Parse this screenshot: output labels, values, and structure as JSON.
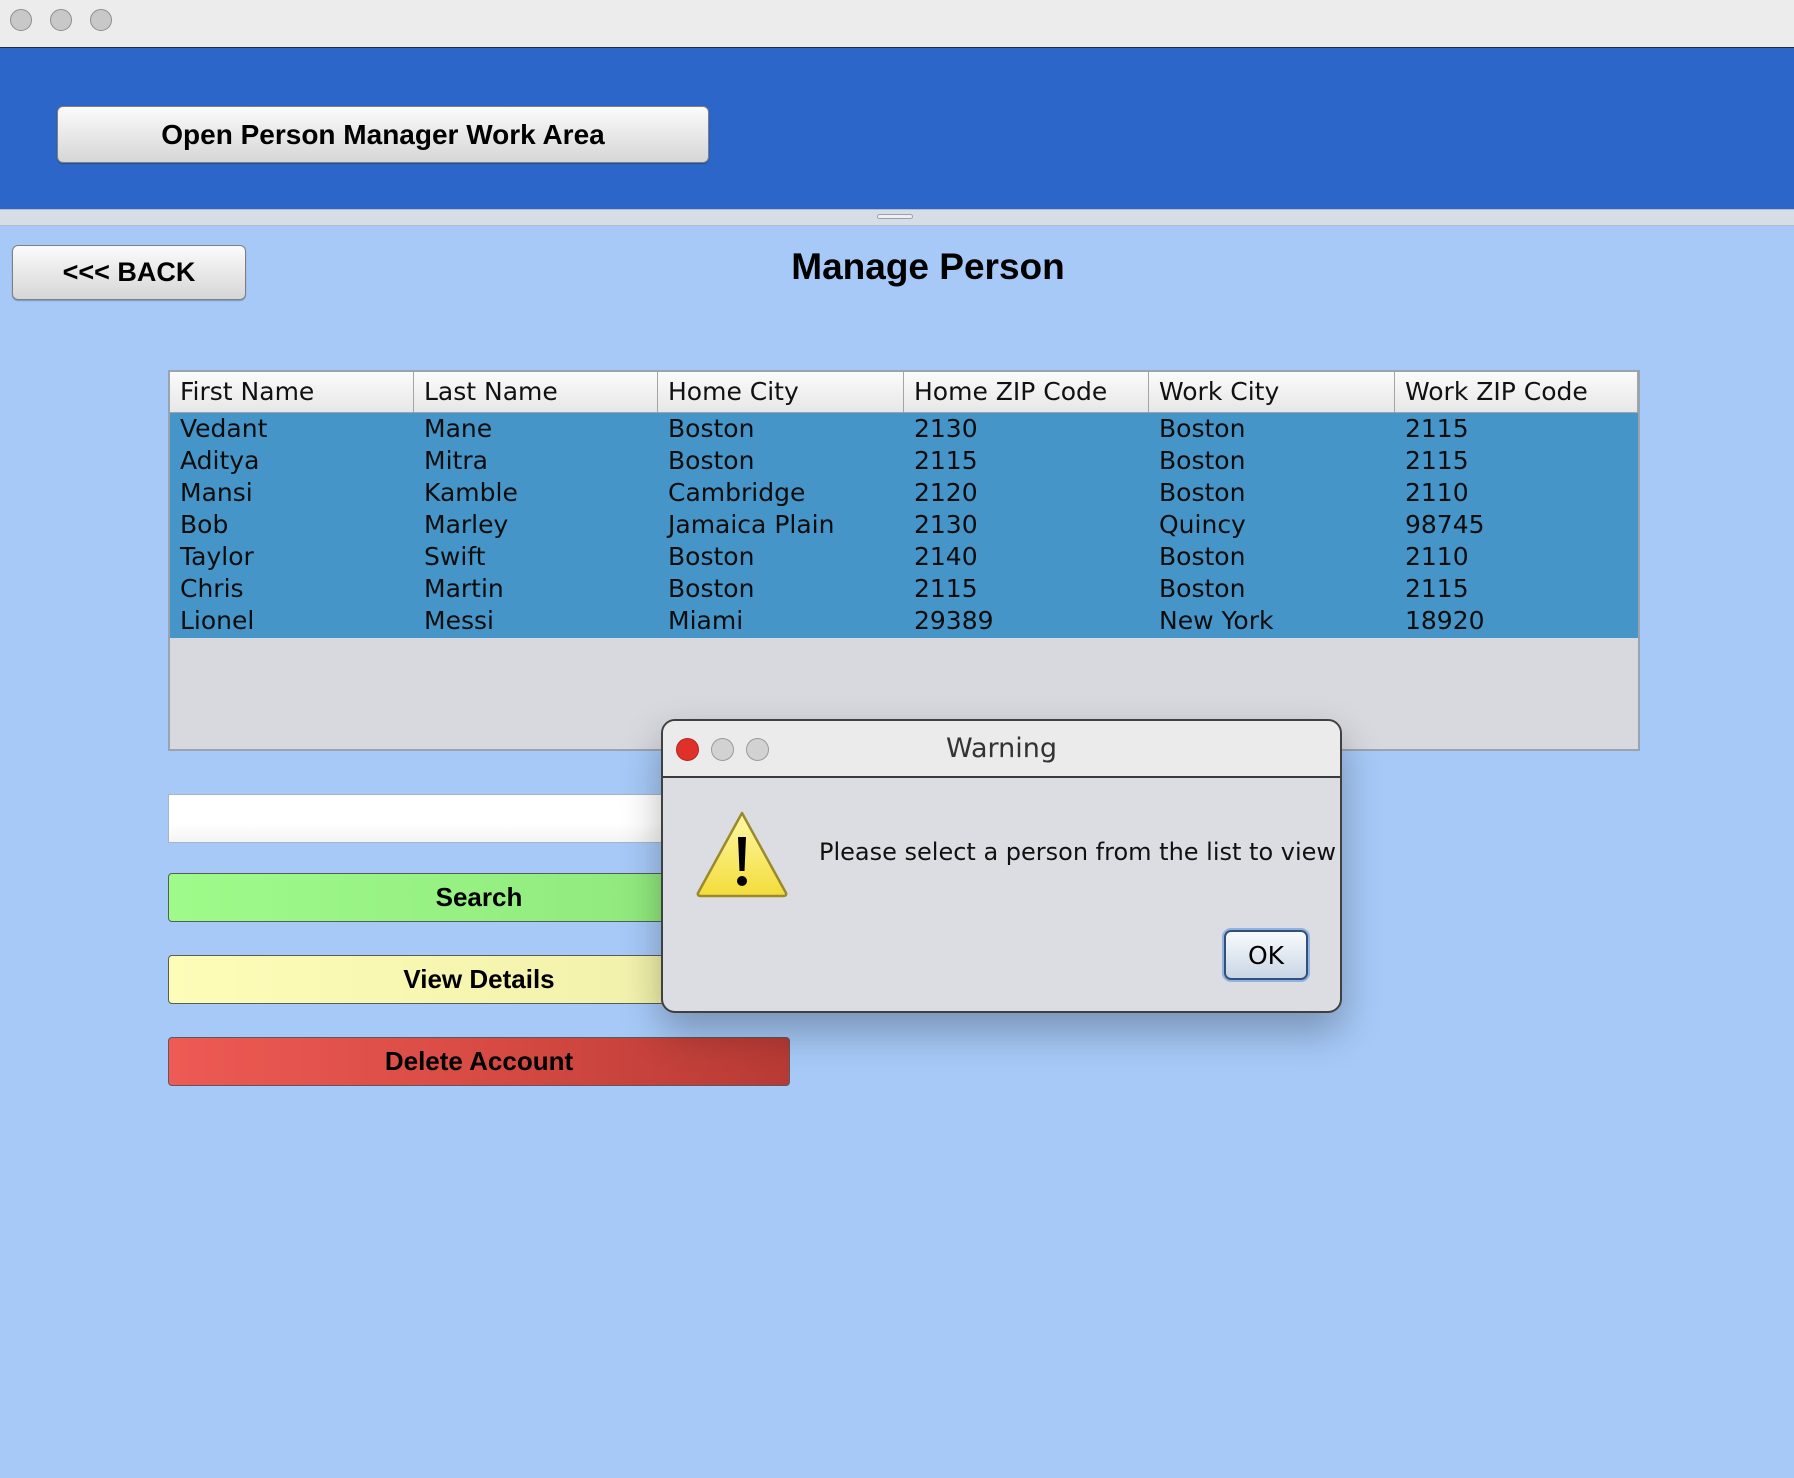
{
  "window": {
    "traffic_lights": [
      "close-button",
      "minimize-button",
      "zoom-button"
    ]
  },
  "top_bar": {
    "open_button_label": "Open Person Manager Work Area"
  },
  "main": {
    "back_label": "<<< BACK",
    "title": "Manage Person",
    "table": {
      "columns": [
        "First Name",
        "Last Name",
        "Home City",
        "Home ZIP Code",
        "Work City",
        "Work ZIP Code"
      ],
      "rows": [
        [
          "Vedant",
          "Mane",
          "Boston",
          "2130",
          "Boston",
          "2115"
        ],
        [
          "Aditya",
          "Mitra",
          "Boston",
          "2115",
          "Boston",
          "2115"
        ],
        [
          "Mansi",
          "Kamble",
          "Cambridge",
          "2120",
          "Boston",
          "2110"
        ],
        [
          "Bob",
          "Marley",
          "Jamaica Plain",
          "2130",
          "Quincy",
          "98745"
        ],
        [
          "Taylor",
          "Swift",
          "Boston",
          "2140",
          "Boston",
          "2110"
        ],
        [
          "Chris",
          "Martin",
          "Boston",
          "2115",
          "Boston",
          "2115"
        ],
        [
          "Lionel",
          "Messi",
          "Miami",
          "29389",
          "New York",
          "18920"
        ]
      ]
    },
    "search_field": {
      "value": "",
      "placeholder": ""
    },
    "search_label": "Search",
    "view_details_label": "View Details",
    "delete_label": "Delete Account"
  },
  "dialog": {
    "title": "Warning",
    "message": "Please select a person from the list to view",
    "ok_label": "OK",
    "icon": "warning-icon"
  },
  "colors": {
    "content_background": "#a6c9f7",
    "top_bar": "#2b66c8",
    "table_selection": "#4595c9",
    "search_button": "#9efb8a",
    "view_details_button": "#fdfdb8",
    "delete_button": "#d84b44"
  }
}
